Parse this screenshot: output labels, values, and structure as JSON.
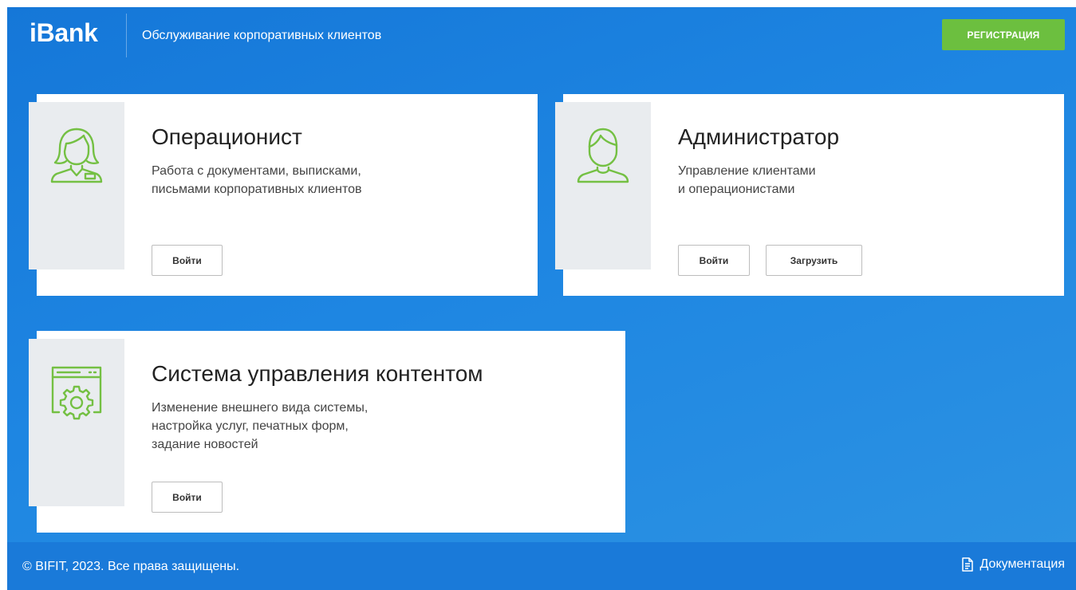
{
  "header": {
    "logo": "iBank",
    "tagline": "Обслуживание корпоративных клиентов",
    "register_label": "РЕГИСТРАЦИЯ"
  },
  "cards": [
    {
      "icon": "operator-icon",
      "title": "Операционист",
      "desc": [
        "Работа с документами, выписками,",
        "письмами корпоративных клиентов"
      ],
      "buttons": [
        "Войти"
      ]
    },
    {
      "icon": "admin-user-icon",
      "title": "Администратор",
      "desc": [
        "Управление клиентами",
        "и операционистами"
      ],
      "buttons": [
        "Войти",
        "Загрузить"
      ]
    },
    {
      "icon": "cms-settings-icon",
      "title": "Система управления контентом",
      "desc": [
        "Изменение внешнего вида системы,",
        "настройка услуг, печатных форм,",
        "задание новостей"
      ],
      "buttons": [
        "Войти"
      ]
    }
  ],
  "footer": {
    "copyright": "© BIFIT, 2023. Все права защищены.",
    "docs_label": "Документация",
    "docs_icon": "document-icon"
  },
  "colors": {
    "background": "#1e86e2",
    "accent_green": "#6cbf3f",
    "icon_green": "#74c043",
    "icon_box": "#e9ecef"
  }
}
